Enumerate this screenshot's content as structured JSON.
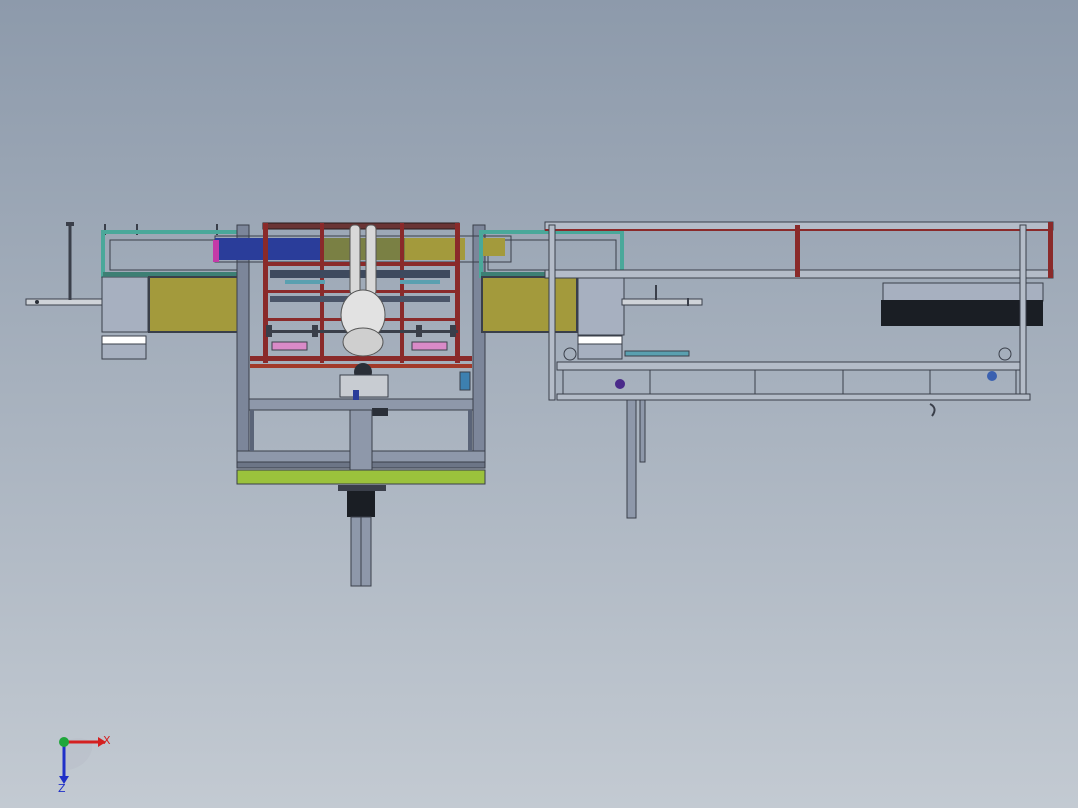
{
  "viewport": {
    "background_top": "#8d9aab",
    "background_bottom": "#c3cad2"
  },
  "triad": {
    "x_label": "X",
    "z_label": "Z",
    "x_color": "#d42020",
    "y_color": "#1fa63a",
    "z_color": "#2030c8"
  },
  "palette": {
    "frame_steel": "#5a6478",
    "frame_teal": "#4aa89a",
    "olive_panel": "#a39a3c",
    "lime_plate": "#9bc23c",
    "rail_red": "#8a2a2a",
    "blue_block": "#2a3d9a",
    "dark_block": "#1a1e24",
    "robot_white": "#e2e2e2"
  }
}
